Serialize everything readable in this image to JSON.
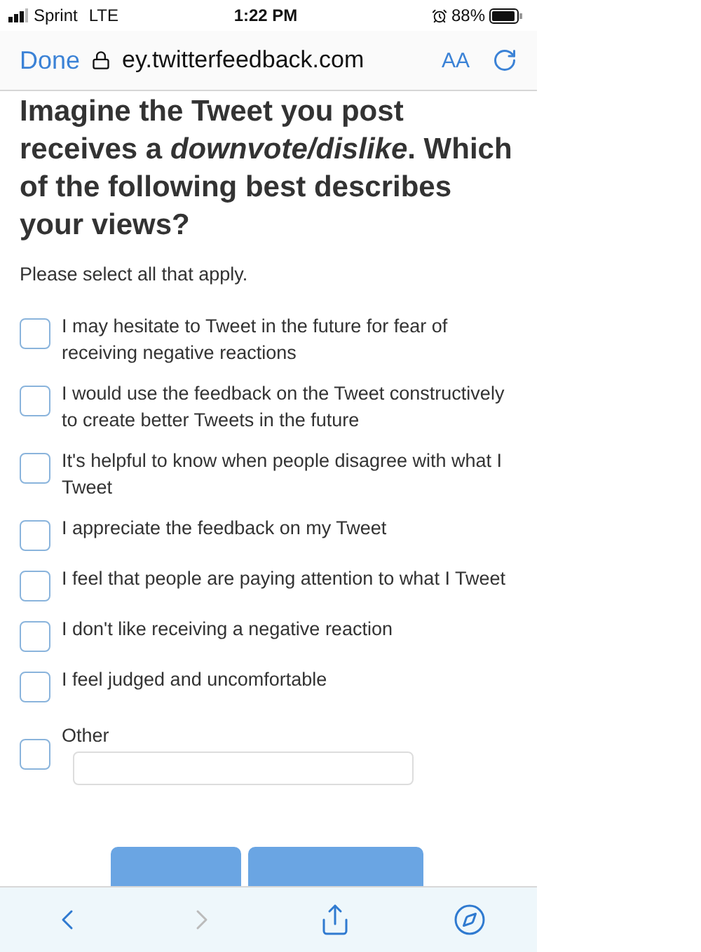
{
  "status_bar": {
    "carrier": "Sprint",
    "network": "LTE",
    "time": "1:22 PM",
    "battery": "88%"
  },
  "browser_bar": {
    "done": "Done",
    "url": "ey.twitterfeedback.com",
    "text_size": "AA"
  },
  "question": {
    "title": "Imagine the Tweet you post receives a *downvote/dislike*. Which of the following best describes your views?",
    "hint": "Please select all that apply."
  },
  "options": [
    {
      "kind": "checkbox",
      "label": "I may hesitate to Tweet in the future for fear of receiving negative reactions",
      "checked": false
    },
    {
      "kind": "checkbox",
      "label": "I would use the feedback on the Tweet constructively to create better Tweets in the future",
      "checked": false
    },
    {
      "kind": "checkbox",
      "label": "It's helpful to know when people disagree with what I Tweet",
      "checked": false
    },
    {
      "kind": "checkbox",
      "label": "I appreciate the feedback on my Tweet",
      "checked": false
    },
    {
      "kind": "checkbox",
      "label": "I feel that people are paying attention to what I Tweet",
      "checked": false
    },
    {
      "kind": "checkbox",
      "label": "I don't like receiving a negative reaction",
      "checked": false
    },
    {
      "kind": "checkbox",
      "label": "I feel judged and uncomfortable",
      "checked": false
    },
    {
      "kind": "other",
      "label": "Other",
      "checked": false
    }
  ],
  "toolbar": [
    {
      "kind": "back",
      "disabled": false
    },
    {
      "kind": "forward",
      "disabled": true
    },
    {
      "kind": "share",
      "disabled": false
    },
    {
      "kind": "compass",
      "disabled": false
    }
  ]
}
